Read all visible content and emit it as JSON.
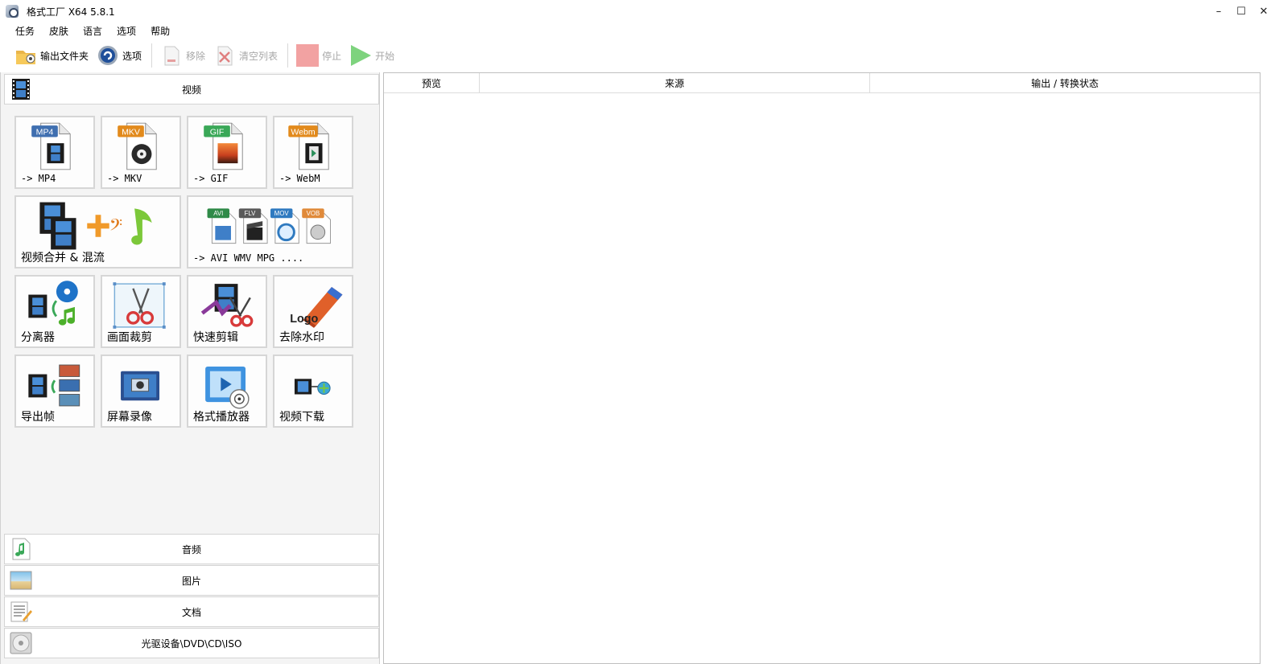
{
  "window": {
    "title": "格式工厂 X64 5.8.1",
    "controls": {
      "minimize": "–",
      "maximize": "☐",
      "close": "✕"
    }
  },
  "menu": [
    "任务",
    "皮肤",
    "语言",
    "选项",
    "帮助"
  ],
  "toolbar": {
    "output_folder": "输出文件夹",
    "options": "选项",
    "remove": "移除",
    "clear_list": "清空列表",
    "stop": "停止",
    "start": "开始"
  },
  "categories": {
    "video": "视频",
    "audio": "音频",
    "image": "图片",
    "document": "文档",
    "disc": "光驱设备\\DVD\\CD\\ISO"
  },
  "video_tiles": {
    "mp4": {
      "badge": "MP4",
      "label": "-> MP4"
    },
    "mkv": {
      "badge": "MKV",
      "label": "-> MKV"
    },
    "gif": {
      "badge": "GIF",
      "label": "-> GIF"
    },
    "webm": {
      "badge": "Webm",
      "label": "-> WebM"
    },
    "merge": {
      "label": "视频合并 & 混流"
    },
    "other": {
      "badges": [
        "AVI",
        "FLV",
        "MOV",
        "VOB"
      ],
      "label": "-> AVI WMV MPG ...."
    },
    "splitter": {
      "label": "分离器"
    },
    "crop": {
      "label": "画面裁剪"
    },
    "quick_cut": {
      "label": "快速剪辑"
    },
    "remove_watermark": {
      "label": "去除水印",
      "logo_text": "Logo"
    },
    "export_frames": {
      "label": "导出帧"
    },
    "screen_record": {
      "label": "屏幕录像"
    },
    "player": {
      "label": "格式播放器"
    },
    "download": {
      "label": "视频下载"
    }
  },
  "task_list": {
    "columns": [
      "预览",
      "来源",
      "输出 / 转换状态"
    ]
  },
  "colors": {
    "mp4_badge": "#3f6fb0",
    "mkv_badge": "#e28a1c",
    "gif_badge": "#3aa858",
    "webm_badge": "#e28a1c",
    "stop": "#f2a2a2",
    "start": "#7ed37e"
  }
}
